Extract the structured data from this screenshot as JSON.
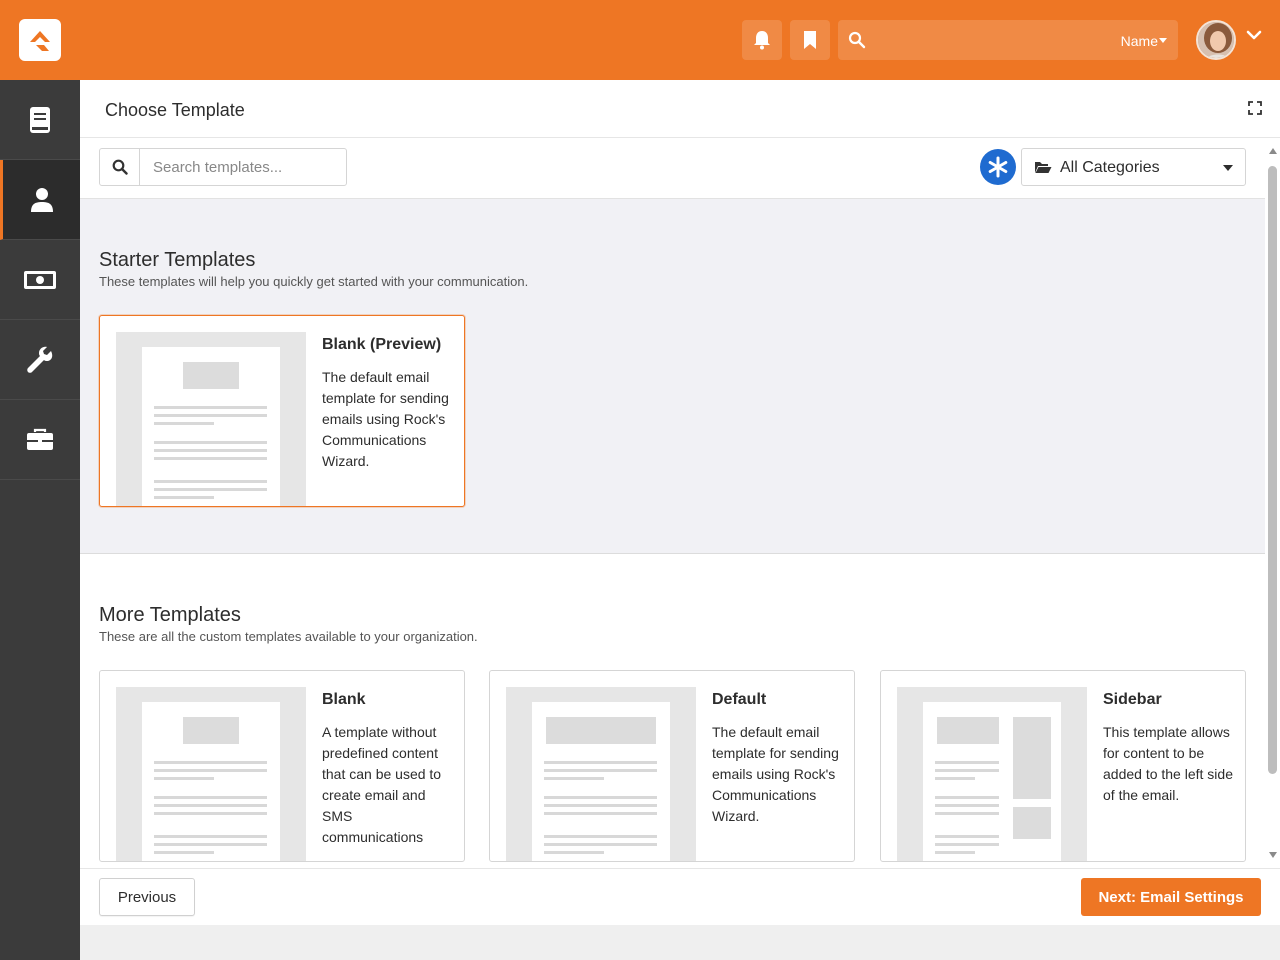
{
  "header": {
    "search_user_label": "Name",
    "search_placeholder": "",
    "brand_color": "#ee7624"
  },
  "sidebar": {
    "items": [
      {
        "icon": "book-icon",
        "active": false
      },
      {
        "icon": "user-icon",
        "active": true
      },
      {
        "icon": "money-icon",
        "active": false
      },
      {
        "icon": "wrench-icon",
        "active": false
      },
      {
        "icon": "briefcase-icon",
        "active": false
      }
    ]
  },
  "page": {
    "title": "Choose Template",
    "search_placeholder": "Search templates...",
    "category_select": "All Categories"
  },
  "starter": {
    "heading": "Starter Templates",
    "subheading": "These templates will help you quickly get started with your communication.",
    "cards": [
      {
        "title": "Blank (Preview)",
        "description": "The default email template for sending emails using Rock's Communications Wizard.",
        "selected": true
      }
    ]
  },
  "more": {
    "heading": "More Templates",
    "subheading": "These are all the custom templates available to your organization.",
    "cards": [
      {
        "title": "Blank",
        "description": "A template without predefined content that can be used to create email and SMS communications"
      },
      {
        "title": "Default",
        "description": "The default email template for sending emails using Rock's Communications Wizard."
      },
      {
        "title": "Sidebar",
        "description": "This template allows for content to be added to the left side of the email."
      }
    ]
  },
  "footer": {
    "previous_label": "Previous",
    "next_label": "Next: Email Settings"
  }
}
